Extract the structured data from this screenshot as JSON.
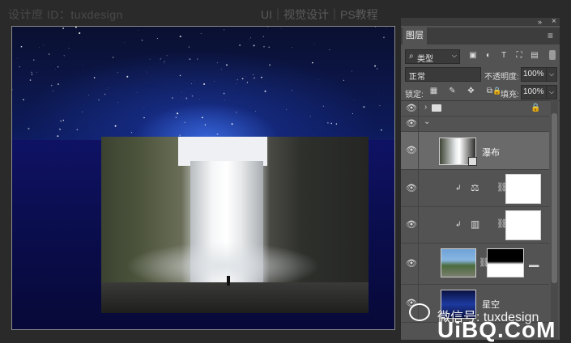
{
  "header": {
    "left_text": "设计庶 ID：tuxdesign",
    "right_text": "UI｜视觉设计｜PS教程"
  },
  "layers_panel": {
    "tab_label": "图层",
    "kind_filter": "类型",
    "blend_mode": "正常",
    "opacity_label": "不透明度:",
    "opacity_value": "100%",
    "lock_label": "锁定:",
    "fill_label": "填充:",
    "fill_value": "100%",
    "layers": [
      {
        "name": "",
        "type": "group"
      },
      {
        "name": "",
        "type": "group-open"
      },
      {
        "name": "瀑布",
        "type": "smart-object",
        "selected": true
      },
      {
        "name": "",
        "type": "levels-adjustment"
      },
      {
        "name": "",
        "type": "gradient-map-adjustment"
      },
      {
        "name": "",
        "type": "masked-image"
      },
      {
        "name": "星空",
        "type": "image"
      }
    ]
  },
  "watermark": {
    "text": "微信号: tuxdesign",
    "footer_logo": "UiBQ.CoM"
  },
  "colors": {
    "panel_bg": "#535353",
    "canvas_sky": "#101f7a",
    "app_bg": "#2a2a2a"
  }
}
